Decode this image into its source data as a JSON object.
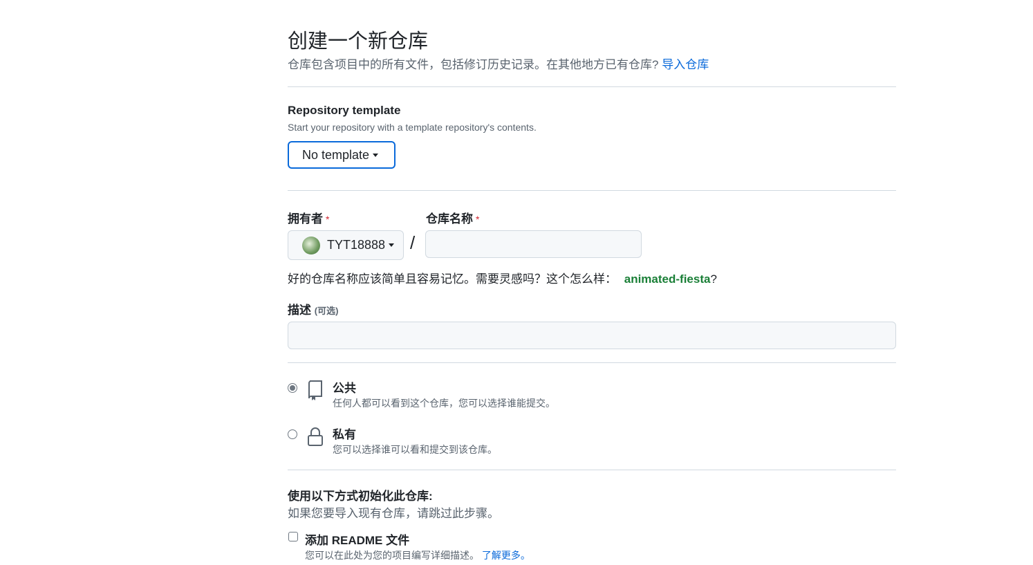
{
  "header": {
    "title": "创建一个新仓库",
    "subtitle": "仓库包含项目中的所有文件，包括修订历史记录。在其他地方已有仓库?",
    "import_link": "导入仓库"
  },
  "template": {
    "label": "Repository template",
    "hint": "Start your repository with a template repository's contents.",
    "button": "No template"
  },
  "owner": {
    "label": "拥有者",
    "required": "*",
    "value": "TYT18888"
  },
  "repo_name": {
    "label": "仓库名称",
    "required": "*",
    "value": "",
    "separator": "/"
  },
  "name_hint": {
    "text": "好的仓库名称应该简单且容易记忆。需要灵感吗？这个怎么样：",
    "suggestion": "animated-fiesta",
    "suffix": "?"
  },
  "description": {
    "label": "描述",
    "optional": "(可选)",
    "value": ""
  },
  "visibility": [
    {
      "title": "公共",
      "desc": "任何人都可以看到这个仓库，您可以选择谁能提交。",
      "selected": true
    },
    {
      "title": "私有",
      "desc": "您可以选择谁可以看和提交到该仓库。",
      "selected": false
    }
  ],
  "init": {
    "title": "使用以下方式初始化此仓库:",
    "hint": "如果您要导入现有仓库，请跳过此步骤。",
    "readme_label": "添加 README 文件",
    "readme_desc": "您可以在此处为您的项目编写详细描述。",
    "learn_more": "了解更多。",
    "readme_checked": false
  }
}
